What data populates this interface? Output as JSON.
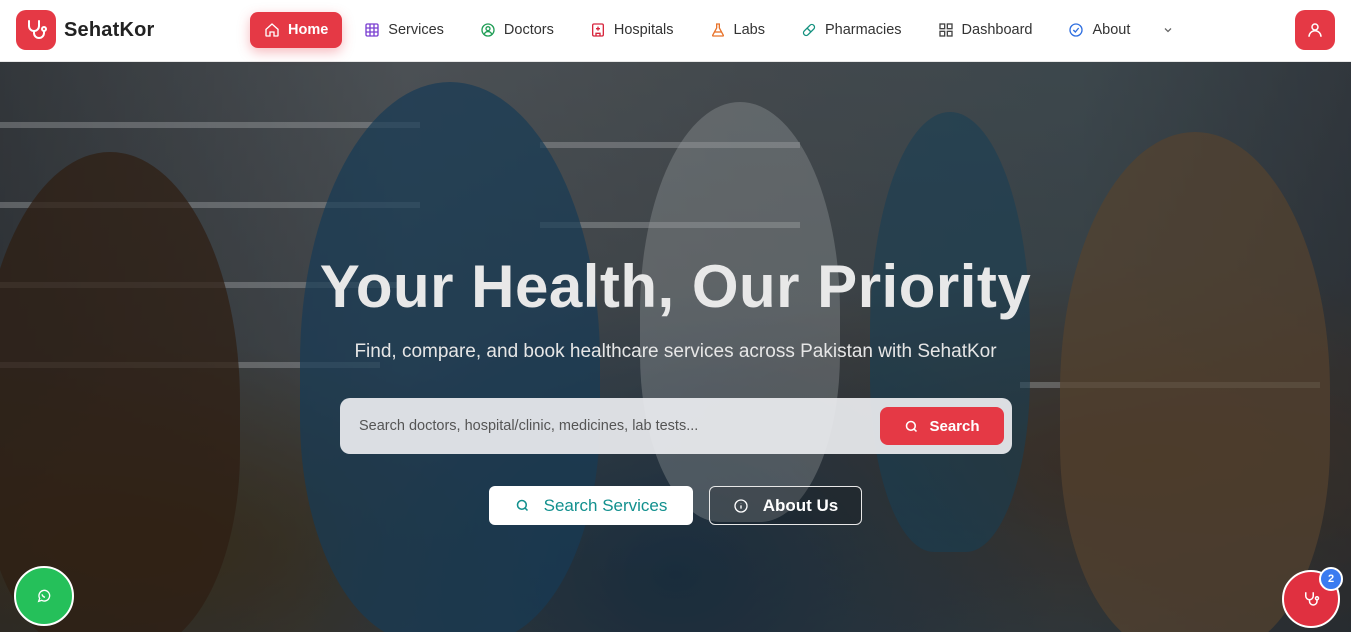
{
  "brand": {
    "name": "SehatKor",
    "logo_icon": "stethoscope-icon"
  },
  "nav": {
    "items": [
      {
        "label": "Home",
        "icon": "home-icon",
        "active": true
      },
      {
        "label": "Services",
        "icon": "grid-icon",
        "active": false
      },
      {
        "label": "Doctors",
        "icon": "doctor-icon",
        "active": false
      },
      {
        "label": "Hospitals",
        "icon": "hospital-icon",
        "active": false
      },
      {
        "label": "Labs",
        "icon": "flask-icon",
        "active": false
      },
      {
        "label": "Pharmacies",
        "icon": "pill-icon",
        "active": false
      },
      {
        "label": "Dashboard",
        "icon": "dashboard-icon",
        "active": false
      },
      {
        "label": "About",
        "icon": "info-check-icon",
        "active": false
      }
    ],
    "more_icon": "chevron-down-icon",
    "profile_icon": "user-icon"
  },
  "hero": {
    "title": "Your Health, Our Priority",
    "subtitle": "Find, compare, and book healthcare services across Pakistan with SehatKor",
    "search": {
      "placeholder": "Search doctors, hospital/clinic, medicines, lab tests...",
      "value": "",
      "button_label": "Search"
    },
    "cta_primary": "Search Services",
    "cta_secondary": "About Us"
  },
  "floating": {
    "whatsapp_icon": "whatsapp-icon",
    "chatbot_icon": "stethoscope-icon",
    "chatbot_badge": "2"
  },
  "colors": {
    "brand_red": "#e53945",
    "teal": "#12908e",
    "whatsapp_green": "#25c05a",
    "badge_blue": "#3a7bf0"
  }
}
